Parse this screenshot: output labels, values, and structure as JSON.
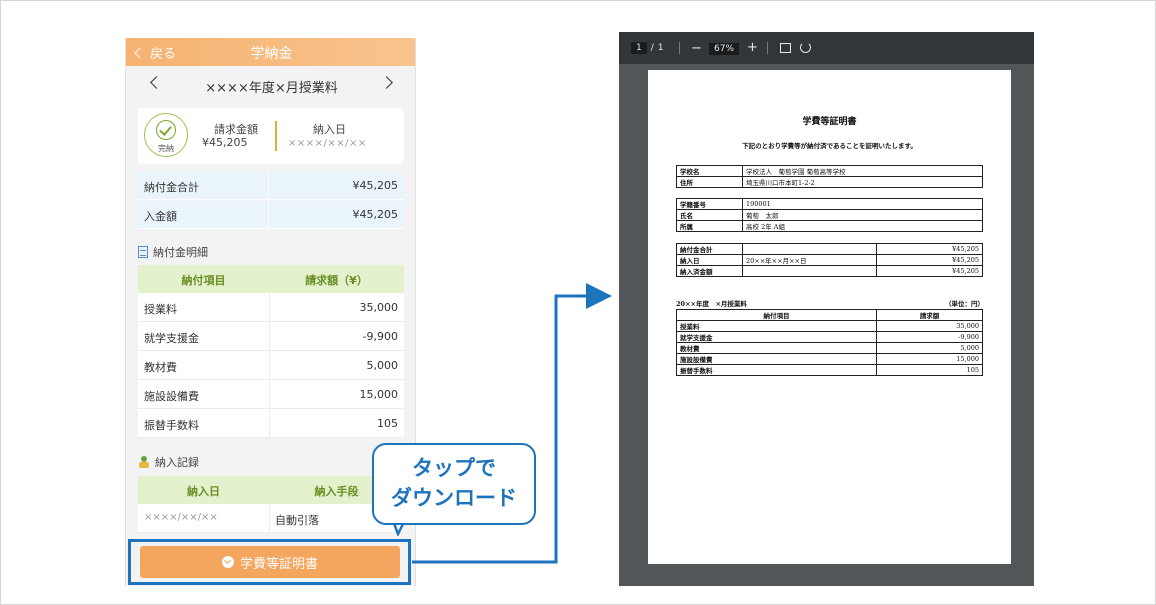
{
  "phone": {
    "header": {
      "back_label": "戻る",
      "title": "学納金"
    },
    "month_nav": {
      "label": "××××年度×月授業料"
    },
    "summary_card": {
      "status": "完納",
      "billing_label": "請求金額",
      "billing_value": "¥45,205",
      "payment_date_label": "納入日",
      "payment_date_value": "××××/××/××"
    },
    "totals": [
      {
        "label": "納付金合計",
        "value": "¥45,205"
      },
      {
        "label": "入金額",
        "value": "¥45,205"
      }
    ],
    "breakdown": {
      "section_title": "納付金明細",
      "headers": [
        "納付項目",
        "請求額（¥）"
      ],
      "rows": [
        {
          "item": "授業料",
          "amount": "35,000"
        },
        {
          "item": "就学支援金",
          "amount": "-9,900"
        },
        {
          "item": "教材費",
          "amount": "5,000"
        },
        {
          "item": "施設設備費",
          "amount": "15,000"
        },
        {
          "item": "振替手数料",
          "amount": "105"
        }
      ]
    },
    "records": {
      "section_title": "納入記録",
      "headers": [
        "納入日",
        "納入手段"
      ],
      "rows": [
        {
          "date": "××××/××/××",
          "method": "自動引落"
        }
      ]
    },
    "download_button": "学費等証明書"
  },
  "callout": {
    "line1": "タップで",
    "line2": "ダウンロード"
  },
  "colors": {
    "accent_blue": "#1e73be",
    "header_orange": "#f6b272",
    "button_orange": "#f4a55e",
    "table_green": "#e3f2cd"
  },
  "pdf_viewer": {
    "toolbar": {
      "page_current": "1",
      "page_sep": "/",
      "page_total": "1",
      "zoom": "67%",
      "minus": "−",
      "plus": "+"
    },
    "document": {
      "title": "学費等証明書",
      "subtitle": "下記のとおり学費等が納付済であることを証明いたします。",
      "school": [
        {
          "label": "学校名",
          "value": "学校法人　葡萄学園 葡萄高等学校"
        },
        {
          "label": "住所",
          "value": "埼玉県川口市本町1-2-2"
        }
      ],
      "student": [
        {
          "label": "学籍番号",
          "value": "190001"
        },
        {
          "label": "氏名",
          "value": "葡萄　太郎"
        },
        {
          "label": "所属",
          "value": "高校 2年 A組"
        }
      ],
      "payment": [
        {
          "label": "納付金合計",
          "mid": "",
          "value": "¥45,205"
        },
        {
          "label": "納入日",
          "mid": "20××年××月××日",
          "value": "¥45,205"
        },
        {
          "label": "納入済金額",
          "mid": "",
          "value": "¥45,205"
        }
      ],
      "detail_caption": "20××年度　×月授業料",
      "detail_unit": "（単位：円）",
      "detail_headers": [
        "納付項目",
        "請求額"
      ],
      "detail_rows": [
        {
          "item": "授業料",
          "amount": "35,000"
        },
        {
          "item": "就学支援金",
          "amount": "-9,900"
        },
        {
          "item": "教材費",
          "amount": "5,000"
        },
        {
          "item": "施設設備費",
          "amount": "15,000"
        },
        {
          "item": "振替手数料",
          "amount": "105"
        }
      ]
    }
  }
}
